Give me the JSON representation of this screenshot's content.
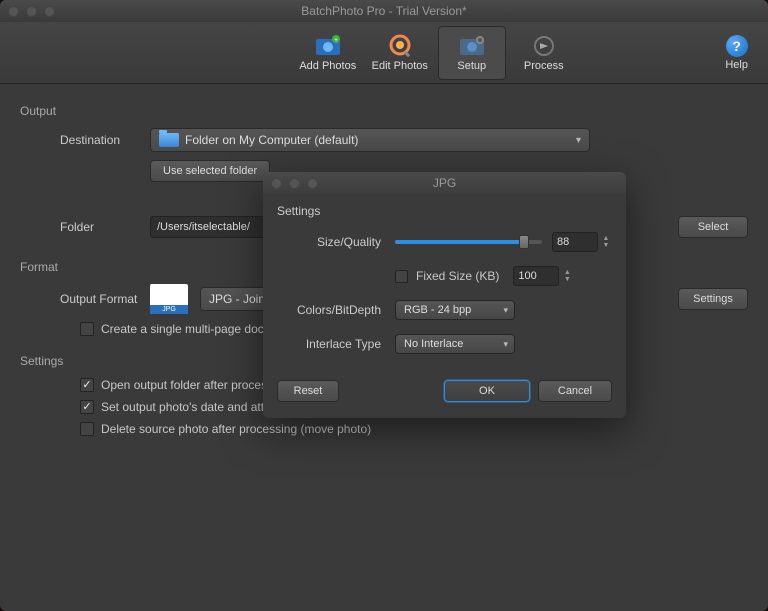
{
  "window": {
    "title": "BatchPhoto Pro - Trial Version*"
  },
  "toolbar": {
    "add_photos": "Add Photos",
    "edit_photos": "Edit Photos",
    "setup": "Setup",
    "process": "Process",
    "help": "Help"
  },
  "output": {
    "heading": "Output",
    "destination_label": "Destination",
    "destination_value": "Folder on My Computer (default)",
    "use_selected_btn": "Use selected folder",
    "folder_label": "Folder",
    "folder_path": "/Users/itselectable/",
    "select_btn": "Select"
  },
  "format": {
    "heading": "Format",
    "output_format_label": "Output Format",
    "output_format_value": "JPG - Joint P",
    "settings_btn": "Settings",
    "single_multipage_label": "Create a single multi-page docume"
  },
  "settings": {
    "heading": "Settings",
    "open_output_label": "Open output folder after processing",
    "same_attrs_label": "Set output photo's date and attributes same as original",
    "delete_source_label": "Delete source photo after processing (move photo)"
  },
  "dialog": {
    "title": "JPG",
    "section": "Settings",
    "size_quality_label": "Size/Quality",
    "quality_value": "88",
    "fixed_size_label": "Fixed Size (KB)",
    "fixed_size_value": "100",
    "colors_label": "Colors/BitDepth",
    "colors_value": "RGB - 24 bpp",
    "interlace_label": "Interlace Type",
    "interlace_value": "No Interlace",
    "reset_btn": "Reset",
    "ok_btn": "OK",
    "cancel_btn": "Cancel"
  }
}
